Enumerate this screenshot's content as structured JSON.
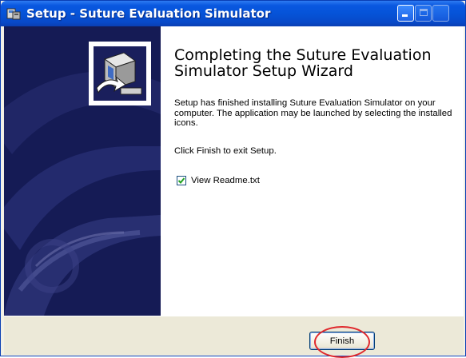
{
  "window": {
    "title": "Setup - Suture Evaluation Simulator",
    "title_icon": "setup-icon",
    "controls": [
      "minimize-icon",
      "maximize-icon",
      "close-icon"
    ]
  },
  "sidebar": {
    "logo_icon": "computer-install-icon"
  },
  "content": {
    "heading": "Completing the Suture Evaluation Simulator Setup Wizard",
    "paragraph1": "Setup has finished installing Suture Evaluation Simulator on your computer. The application may be launched by selecting the installed icons.",
    "paragraph2": "Click Finish to exit Setup.",
    "checkbox": {
      "label": "View Readme.txt",
      "checked": true
    }
  },
  "footer": {
    "finish_label": "Finish"
  },
  "colors": {
    "titlebar": "#0553d8",
    "sidebar": "#151b55",
    "annotation_circle": "#e0282c"
  }
}
